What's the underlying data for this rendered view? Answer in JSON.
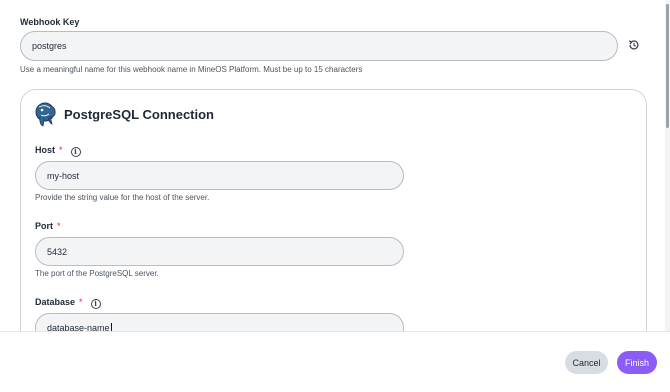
{
  "webhook_key": {
    "label": "Webhook Key",
    "value": "postgres",
    "helper": "Use a meaningful name for this webhook name in MineOS Platform. Must be up to 15 characters"
  },
  "connection": {
    "title": "PostgreSQL Connection",
    "host": {
      "label": "Host",
      "required_mark": "*",
      "value": "my-host",
      "helper": "Provide the string value for the host of the server."
    },
    "port": {
      "label": "Port",
      "required_mark": "*",
      "value": "5432",
      "helper": "The port of the PostgreSQL server."
    },
    "database": {
      "label": "Database",
      "required_mark": "*",
      "value": "database-name"
    }
  },
  "footer": {
    "cancel_label": "Cancel",
    "finish_label": "Finish"
  },
  "icons": {
    "info": "i",
    "reset": "reset-icon",
    "logo": "postgresql-logo"
  },
  "colors": {
    "accent": "#8b5cf6",
    "required": "#e11d48",
    "input_bg": "#f3f4f6"
  }
}
